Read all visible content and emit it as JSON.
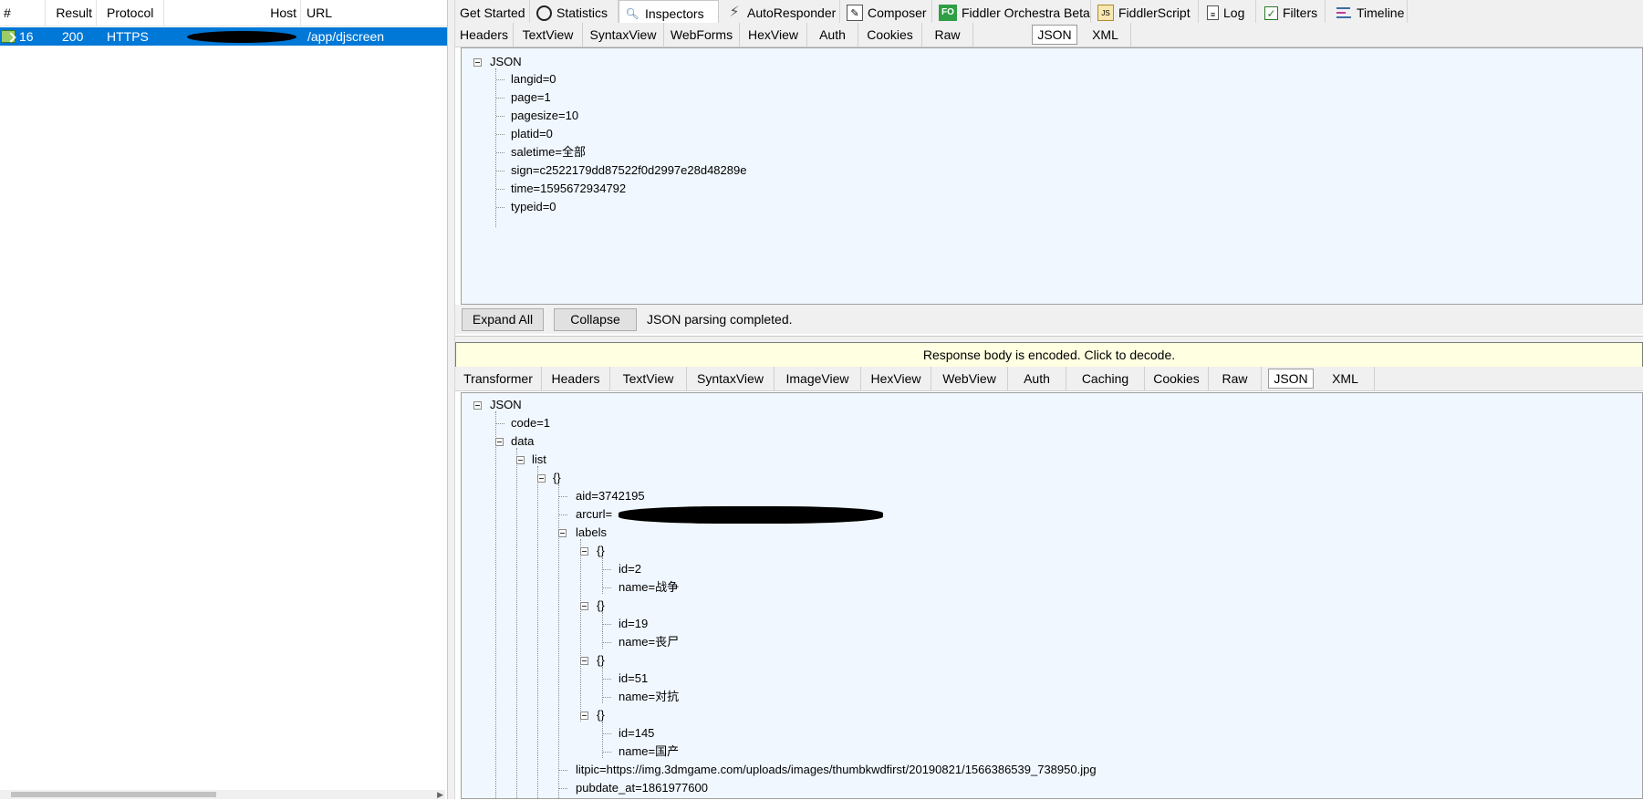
{
  "sessions": {
    "columns": [
      "#",
      "Result",
      "Protocol",
      "Host",
      "URL"
    ],
    "row": {
      "id": "16",
      "result": "200",
      "protocol": "HTTPS",
      "url": "/app/djscreen"
    }
  },
  "top_tabs": [
    {
      "label": "Get Started",
      "icon": ""
    },
    {
      "label": "Statistics",
      "icon": "stopwatch-icon"
    },
    {
      "label": "Inspectors",
      "icon": "magnifier-icon"
    },
    {
      "label": "AutoResponder",
      "icon": "lightning-icon"
    },
    {
      "label": "Composer",
      "icon": "pencil-icon"
    },
    {
      "label": "Fiddler Orchestra Beta",
      "icon": "fo-icon",
      "icon_text": "FO"
    },
    {
      "label": "FiddlerScript",
      "icon": "script-icon"
    },
    {
      "label": "Log",
      "icon": "document-icon"
    },
    {
      "label": "Filters",
      "icon": "checkbox-icon"
    },
    {
      "label": "Timeline",
      "icon": "timeline-icon"
    }
  ],
  "request_tabs": [
    "Headers",
    "TextView",
    "SyntaxView",
    "WebForms",
    "HexView",
    "Auth",
    "Cookies",
    "Raw",
    "JSON",
    "XML"
  ],
  "request_tree": {
    "root": "JSON",
    "items": [
      "langid=0",
      "page=1",
      "pagesize=10",
      "platid=0",
      "saletime=全部",
      "sign=c2522179dd87522f0d2997e28d48289e",
      "time=1595672934792",
      "typeid=0"
    ]
  },
  "buttons": {
    "expand": "Expand All",
    "collapse": "Collapse",
    "status": "JSON parsing completed."
  },
  "banner": "Response body is encoded. Click to decode.",
  "response_tabs": [
    "Transformer",
    "Headers",
    "TextView",
    "SyntaxView",
    "ImageView",
    "HexView",
    "WebView",
    "Auth",
    "Caching",
    "Cookies",
    "Raw",
    "JSON",
    "XML"
  ],
  "response_tree": {
    "root": "JSON",
    "code": "code=1",
    "data": "data",
    "list": "list",
    "obj": "{}",
    "aid": "aid=3742195",
    "arcurl": "arcurl=",
    "labels": "labels",
    "label_items": [
      {
        "id": "id=2",
        "name": "name=战争"
      },
      {
        "id": "id=19",
        "name": "name=丧尸"
      },
      {
        "id": "id=51",
        "name": "name=对抗"
      },
      {
        "id": "id=145",
        "name": "name=国产"
      }
    ],
    "litpic": "litpic=https://img.3dmgame.com/uploads/images/thumbkwdfirst/20190821/1566386539_738950.jpg",
    "pubdate": "pubdate_at=1861977600"
  },
  "colors": {
    "selection": "#0078d7",
    "tree_bg": "#f0f7ff",
    "banner_bg": "#ffffe1"
  }
}
